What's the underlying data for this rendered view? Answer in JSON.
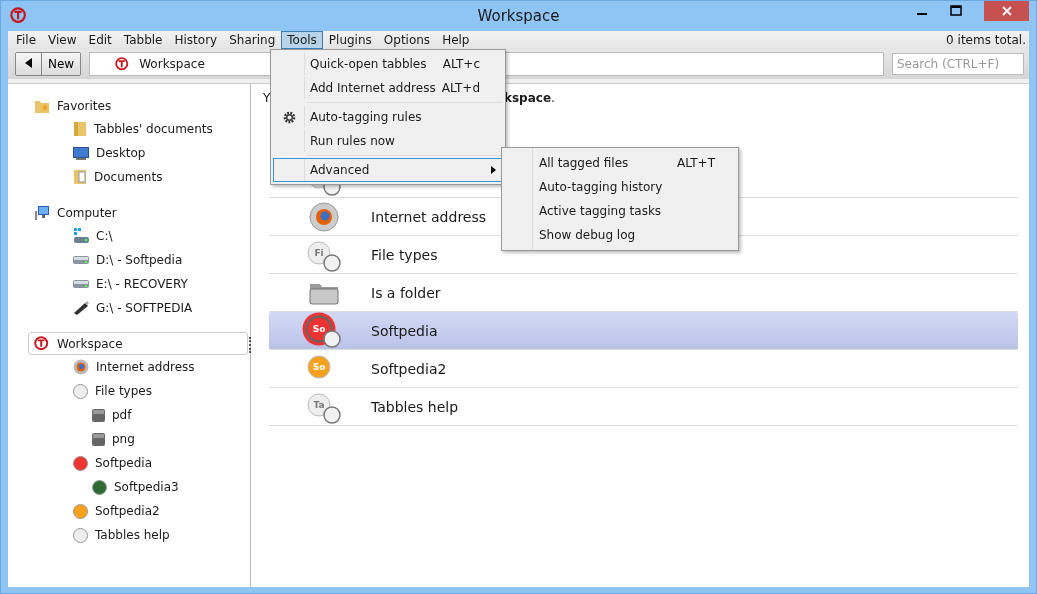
{
  "window": {
    "title": "Workspace"
  },
  "menu": [
    {
      "label": "File",
      "selected": false
    },
    {
      "label": "View",
      "selected": false
    },
    {
      "label": "Edit",
      "selected": false
    },
    {
      "label": "Tabble",
      "selected": false
    },
    {
      "label": "History",
      "selected": false
    },
    {
      "label": "Sharing",
      "selected": false
    },
    {
      "label": "Tools",
      "selected": true
    },
    {
      "label": "Plugins",
      "selected": false
    },
    {
      "label": "Options",
      "selected": false
    },
    {
      "label": "Help",
      "selected": false
    }
  ],
  "items_total": "0 items total.",
  "toolbar": {
    "new_button": "New",
    "path": "Workspace",
    "search": {
      "placeholder": "Search (CTRL+F)"
    }
  },
  "sidebar": [
    {
      "label": "Favorites",
      "kind": "favorites",
      "selected": false,
      "children": [
        {
          "label": "Tabbles' documents",
          "kind": "folder"
        },
        {
          "label": "Desktop",
          "kind": "desktop"
        },
        {
          "label": "Documents",
          "kind": "documents"
        }
      ]
    },
    {
      "label": "Computer",
      "kind": "computer",
      "selected": false,
      "children": [
        {
          "label": "C:\\",
          "kind": "system-drive"
        },
        {
          "label": "D:\\ - Softpedia",
          "kind": "drive"
        },
        {
          "label": "E:\\ - RECOVERY",
          "kind": "drive"
        },
        {
          "label": "G:\\ - SOFTPEDIA",
          "kind": "usb"
        }
      ]
    },
    {
      "label": "Workspace",
      "kind": "workspace",
      "selected": true,
      "children": [
        {
          "label": "Internet address",
          "kind": "firefox"
        },
        {
          "label": "File types",
          "kind": "dot",
          "color": "#eeeeee",
          "children": [
            {
              "label": "pdf",
              "kind": "square"
            },
            {
              "label": "png",
              "kind": "square"
            }
          ]
        },
        {
          "label": "Softpedia",
          "kind": "dot",
          "color": "#ee3333",
          "children": [
            {
              "label": "Softpedia3",
              "kind": "dot",
              "color": "#2e6b34"
            }
          ]
        },
        {
          "label": "Softpedia2",
          "kind": "dot",
          "color": "#f7a21e"
        },
        {
          "label": "Tabbles help",
          "kind": "dot",
          "color": "#eeeeee"
        }
      ]
    }
  ],
  "content": {
    "intro_start": "Y",
    "intro_end": "**kspace**.",
    "tiles": [
      {
        "kind": "tabble",
        "selected": false
      },
      {
        "label": "Internet address",
        "kind": "firefox",
        "selected": false
      },
      {
        "label": "File types",
        "kind": "tabble",
        "badge": "Fi",
        "color": "#eeeeee",
        "selected": false
      },
      {
        "label": "Is a folder",
        "kind": "folder",
        "selected": false
      },
      {
        "label": "Softpedia",
        "kind": "tabble",
        "badge": "So",
        "color": "#ee3333",
        "selected": true
      },
      {
        "label": "Softpedia2",
        "kind": "tabble",
        "badge": "So",
        "color": "#f7a21e",
        "selected": false
      },
      {
        "label": "Tabbles help",
        "kind": "tabble",
        "badge": "Ta",
        "color": "#eeeeee",
        "selected": false
      }
    ]
  },
  "tools_menu": [
    {
      "label": "Quick-open tabbles",
      "shortcut": "ALT+c",
      "kind": "item",
      "selected": false
    },
    {
      "label": "Add Internet address",
      "shortcut": "ALT+d",
      "kind": "item",
      "selected": false
    },
    {
      "kind": "separator"
    },
    {
      "label": "Auto-tagging rules",
      "kind": "gear",
      "selected": false
    },
    {
      "label": "Run rules now",
      "kind": "item",
      "selected": false
    },
    {
      "kind": "separator"
    },
    {
      "label": "Advanced",
      "kind": "submenu",
      "selected": true
    }
  ],
  "advanced_menu": [
    {
      "label": "All tagged files",
      "shortcut": "ALT+T"
    },
    {
      "label": "Auto-tagging history"
    },
    {
      "label": "Active tagging tasks"
    },
    {
      "label": "Show debug log"
    }
  ]
}
